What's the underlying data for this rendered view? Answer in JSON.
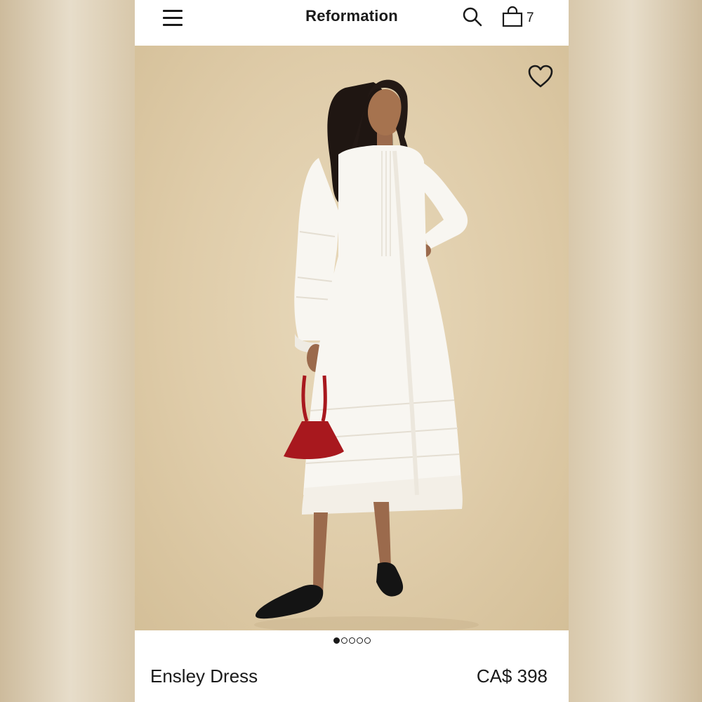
{
  "header": {
    "brand": "Reformation",
    "bag_count": "7",
    "icons": {
      "menu": "hamburger-menu-icon",
      "search": "search-icon",
      "bag": "shopping-bag-icon"
    }
  },
  "hero": {
    "image_description_name": "product-photo",
    "favorite_icon": "heart-icon"
  },
  "carousel": {
    "total_slides": 5,
    "active_index": 0
  },
  "product": {
    "name": "Ensley Dress",
    "price": "CA$ 398"
  },
  "colors": {
    "text": "#1a1a1a",
    "backdrop": "#dfcca9",
    "dress": "#f8f6f1",
    "bag": "#a8181e",
    "shoes": "#141414"
  }
}
